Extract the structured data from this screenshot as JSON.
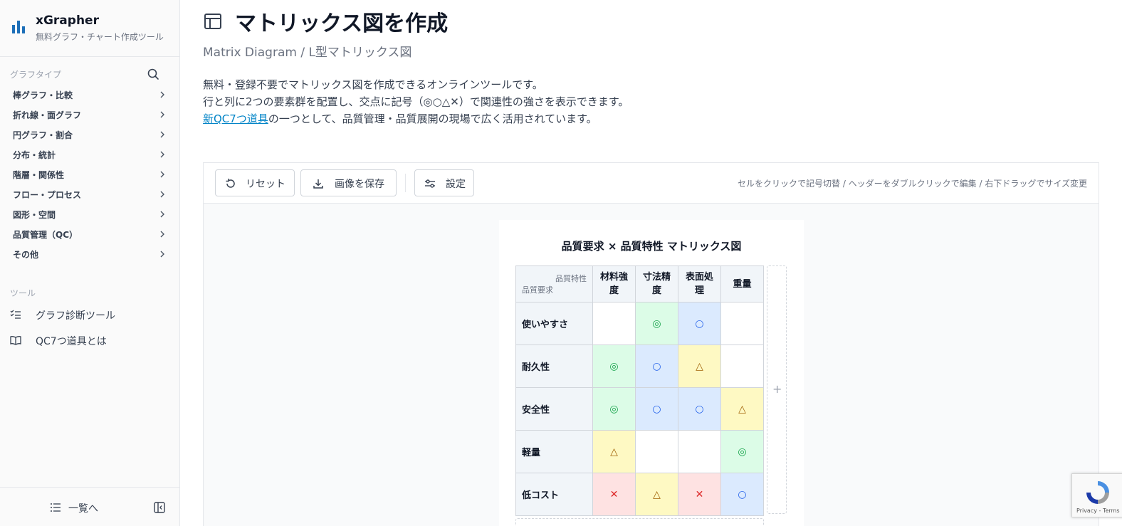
{
  "brand": {
    "name": "xGrapher",
    "tagline": "無料グラフ・チャート作成ツール"
  },
  "sidebar": {
    "graph_types_title": "グラフタイプ",
    "items": [
      {
        "label": "棒グラフ・比較"
      },
      {
        "label": "折れ線・面グラフ"
      },
      {
        "label": "円グラフ・割合"
      },
      {
        "label": "分布・統計"
      },
      {
        "label": "階層・関係性"
      },
      {
        "label": "フロー・プロセス"
      },
      {
        "label": "図形・空間"
      },
      {
        "label": "品質管理（QC）"
      },
      {
        "label": "その他"
      }
    ],
    "tools_title": "ツール",
    "tools": [
      {
        "label": "グラフ診断ツール"
      },
      {
        "label": "QC7つ道具とは"
      }
    ],
    "back_label": "一覧へ"
  },
  "page": {
    "title": "マトリックス図を作成",
    "subtitle": "Matrix Diagram / L型マトリックス図",
    "desc1": "無料・登録不要でマトリックス図を作成できるオンラインツールです。",
    "desc2": "行と列に2つの要素群を配置し、交点に記号（◎○△✕）で関連性の強さを表示できます。",
    "desc3_link": "新QC7つ道具",
    "desc3_rest": "の一つとして、品質管理・品質展開の現場で広く活用されています。"
  },
  "toolbar": {
    "reset_label": "リセット",
    "save_label": "画像を保存",
    "settings_label": "設定",
    "hint": "セルをクリックで記号切替 / ヘッダーをダブルクリックで編集 / 右下ドラッグでサイズ変更"
  },
  "matrix": {
    "title": "品質要求 × 品質特性 マトリックス図",
    "corner_col_label": "品質特性",
    "corner_row_label": "品質要求",
    "columns": [
      "材料強度",
      "寸法精度",
      "表面処理",
      "重量"
    ],
    "rows": [
      {
        "label": "使いやすさ",
        "cells": [
          "",
          "◎",
          "○",
          ""
        ]
      },
      {
        "label": "耐久性",
        "cells": [
          "◎",
          "○",
          "△",
          ""
        ]
      },
      {
        "label": "安全性",
        "cells": [
          "◎",
          "○",
          "○",
          "△"
        ]
      },
      {
        "label": "軽量",
        "cells": [
          "△",
          "",
          "",
          "◎"
        ]
      },
      {
        "label": "低コスト",
        "cells": [
          "✕",
          "△",
          "✕",
          "○"
        ]
      }
    ],
    "add_symbol": "+",
    "symbol_styles": {
      "◎": {
        "bg": "#dcfce7",
        "color": "#16a34a"
      },
      "○": {
        "bg": "#dbeafe",
        "color": "#2563eb"
      },
      "△": {
        "bg": "#fef9c3",
        "color": "#a16207"
      },
      "✕": {
        "bg": "#fee2e2",
        "color": "#dc2626"
      },
      "": {
        "bg": "#ffffff",
        "color": "#111827"
      }
    }
  },
  "recaptcha": {
    "links": "Privacy - Terms"
  },
  "colors": {
    "accent": "#0284c7",
    "brand": "#1d6fb8"
  }
}
